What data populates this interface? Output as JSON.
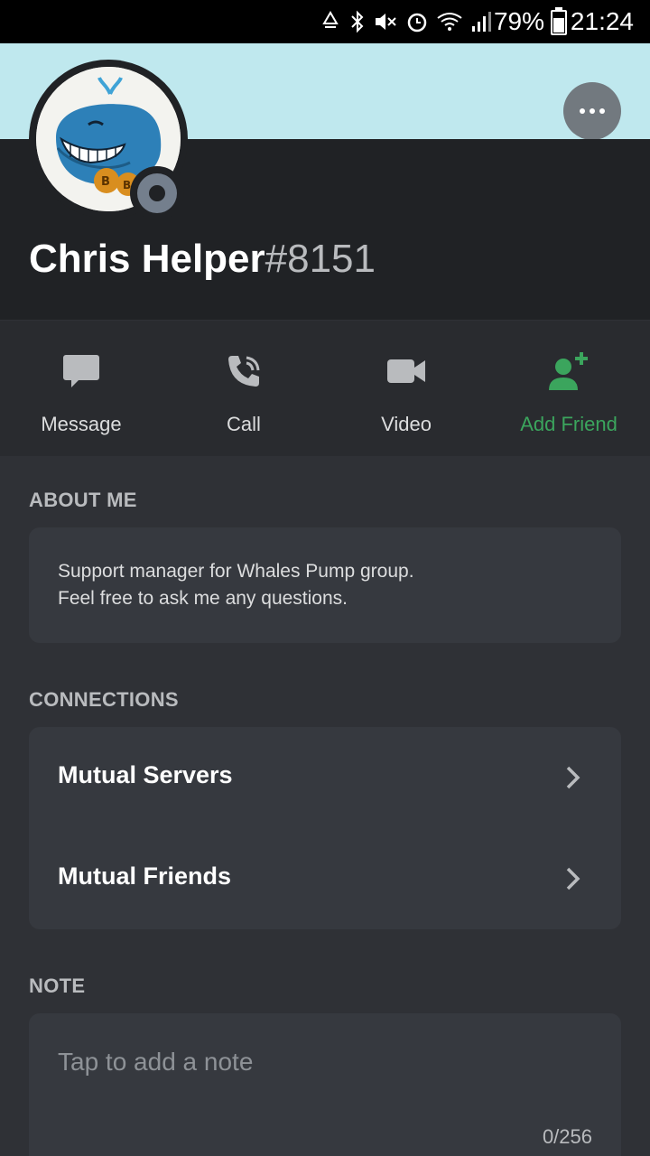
{
  "status_bar": {
    "battery": "79%",
    "time": "21:24",
    "icons": [
      "recycle-icon",
      "bluetooth-icon",
      "mute-icon",
      "alarm-icon",
      "wifi-icon",
      "signal-icon"
    ]
  },
  "profile": {
    "username": "Chris Helper",
    "discriminator": "#8151",
    "status": "offline",
    "banner_color": "#bfe8ee"
  },
  "actions": [
    {
      "label": "Message",
      "icon": "message-icon"
    },
    {
      "label": "Call",
      "icon": "call-icon"
    },
    {
      "label": "Video",
      "icon": "video-icon"
    },
    {
      "label": "Add Friend",
      "icon": "add-friend-icon",
      "color": "#3ba55d"
    }
  ],
  "about": {
    "title": "ABOUT ME",
    "lines": [
      "Support manager for Whales Pump group.",
      "Feel free to ask me any questions."
    ]
  },
  "connections": {
    "title": "CONNECTIONS",
    "items": [
      {
        "label": "Mutual Servers"
      },
      {
        "label": "Mutual Friends"
      }
    ]
  },
  "note": {
    "title": "NOTE",
    "placeholder": "Tap to add a note",
    "counter": "0/256"
  }
}
